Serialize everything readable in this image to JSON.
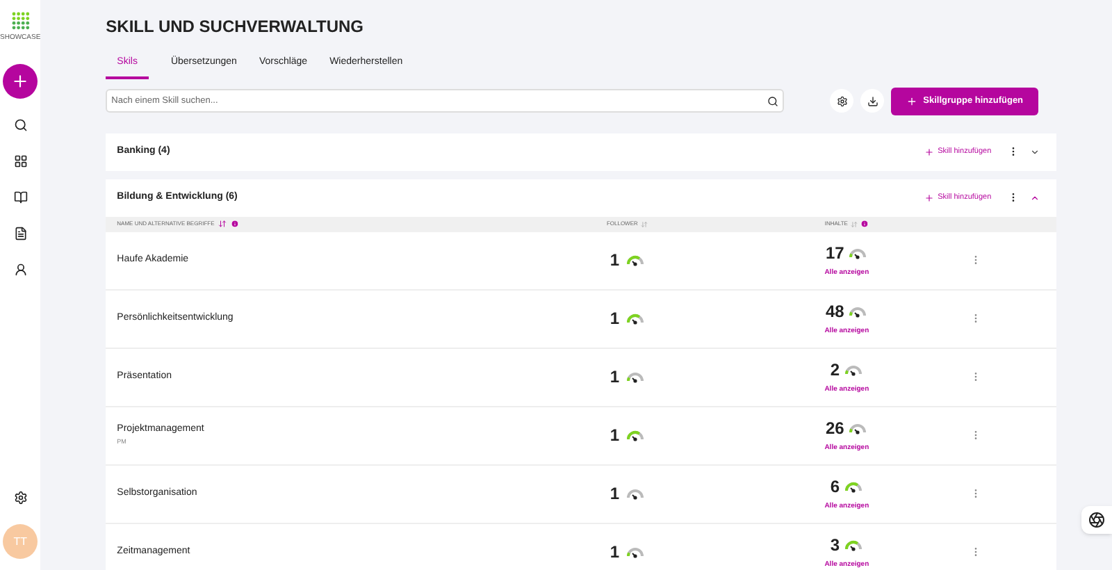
{
  "logo": {
    "text": "SHOWCASE"
  },
  "sidebar": {
    "items": [
      {
        "kind": "search"
      },
      {
        "kind": "grid"
      },
      {
        "kind": "book"
      },
      {
        "kind": "doc"
      },
      {
        "kind": "user"
      }
    ],
    "avatar": "TT"
  },
  "title": "SKILL UND SUCHVERWALTUNG",
  "tabs": [
    {
      "label": "Skils",
      "selected": true
    },
    {
      "label": "Übersetzungen",
      "selected": false
    },
    {
      "label": "Vorschläge",
      "selected": false
    },
    {
      "label": "Wiederherstellen",
      "selected": false
    }
  ],
  "search": {
    "placeholder": "Nach einem Skill suchen..."
  },
  "add_group_button": "Skillgruppe hinzufügen",
  "groups": [
    {
      "title": "Banking (4)",
      "add_skill": "Skill hinzufügen",
      "expanded": false
    },
    {
      "title": "Bildung & Entwicklung (6)",
      "add_skill": "Skill hinzufügen",
      "expanded": true,
      "columns": [
        "NAME UND ALTERNATIVE BEGRIFFE",
        "FOLLOWER",
        "INHALTE"
      ],
      "rows": [
        {
          "name": "Haufe Akademie",
          "followers": {
            "count": "1",
            "kind": "high"
          },
          "contents": {
            "count": "17",
            "kind": "low"
          },
          "link": "Alle anzeigen"
        },
        {
          "name": "Persönlichkeitsentwicklung",
          "followers": {
            "count": "1",
            "kind": "high"
          },
          "contents": {
            "count": "48",
            "kind": "low"
          },
          "link": "Alle anzeigen"
        },
        {
          "name": "Präsentation",
          "followers": {
            "count": "1",
            "kind": "low"
          },
          "contents": {
            "count": "2",
            "kind": "low"
          },
          "link": "Alle anzeigen"
        },
        {
          "name": "Projektmanagement",
          "alt": "PM",
          "followers": {
            "count": "1",
            "kind": "high"
          },
          "contents": {
            "count": "26",
            "kind": "low"
          },
          "link": "Alle anzeigen"
        },
        {
          "name": "Selbstorganisation",
          "followers": {
            "count": "1",
            "kind": "empty"
          },
          "contents": {
            "count": "6",
            "kind": "high"
          },
          "link": "Alle anzeigen"
        },
        {
          "name": "Zeitmanagement",
          "followers": {
            "count": "1",
            "kind": "low"
          },
          "contents": {
            "count": "3",
            "kind": "high"
          },
          "link": "Alle anzeigen"
        }
      ]
    }
  ]
}
